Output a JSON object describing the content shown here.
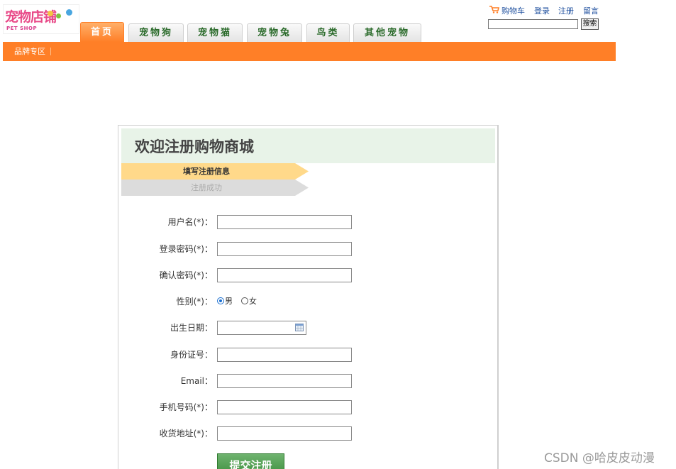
{
  "logo": {
    "main_text": "宠物店铺",
    "sub_text": "PET SHOP"
  },
  "nav": {
    "tabs": [
      {
        "label": "首页",
        "active": true
      },
      {
        "label": "宠物狗",
        "active": false
      },
      {
        "label": "宠物猫",
        "active": false
      },
      {
        "label": "宠物兔",
        "active": false
      },
      {
        "label": "鸟类",
        "active": false
      },
      {
        "label": "其他宠物",
        "active": false
      }
    ]
  },
  "toplinks": {
    "cart": "购物车",
    "login": "登录",
    "register": "注册",
    "message": "留言"
  },
  "search": {
    "value": "",
    "button_label": "搜索"
  },
  "subnav": {
    "brand": "品牌专区"
  },
  "register": {
    "title": "欢迎注册购物商城",
    "steps": [
      {
        "label": "填写注册信息",
        "active": true
      },
      {
        "label": "注册成功",
        "active": false
      }
    ],
    "fields": {
      "username": {
        "label": "用户名(*)：",
        "value": ""
      },
      "password": {
        "label": "登录密码(*)：",
        "value": ""
      },
      "confirm_password": {
        "label": "确认密码(*)：",
        "value": ""
      },
      "gender": {
        "label": "性别(*)：",
        "options": [
          "男",
          "女"
        ],
        "selected": "男"
      },
      "birthday": {
        "label": "出生日期：",
        "value": ""
      },
      "id_number": {
        "label": "身份证号：",
        "value": ""
      },
      "email": {
        "label": "Email：",
        "value": ""
      },
      "phone": {
        "label": "手机号码(*)：",
        "value": ""
      },
      "address": {
        "label": "收货地址(*)：",
        "value": ""
      }
    },
    "submit_label": "提交注册"
  },
  "watermark": "CSDN @哈皮皮动漫",
  "colors": {
    "accent": "#ff7f27",
    "nav_text": "#2a6a2a",
    "header_bg": "#e8f3e8",
    "step_active": "#ffd98a",
    "step_inactive": "#dcdcdc",
    "submit": "#4a9a4a"
  },
  "icons": {
    "cart": "shopping-cart-icon",
    "calendar": "calendar-icon"
  }
}
